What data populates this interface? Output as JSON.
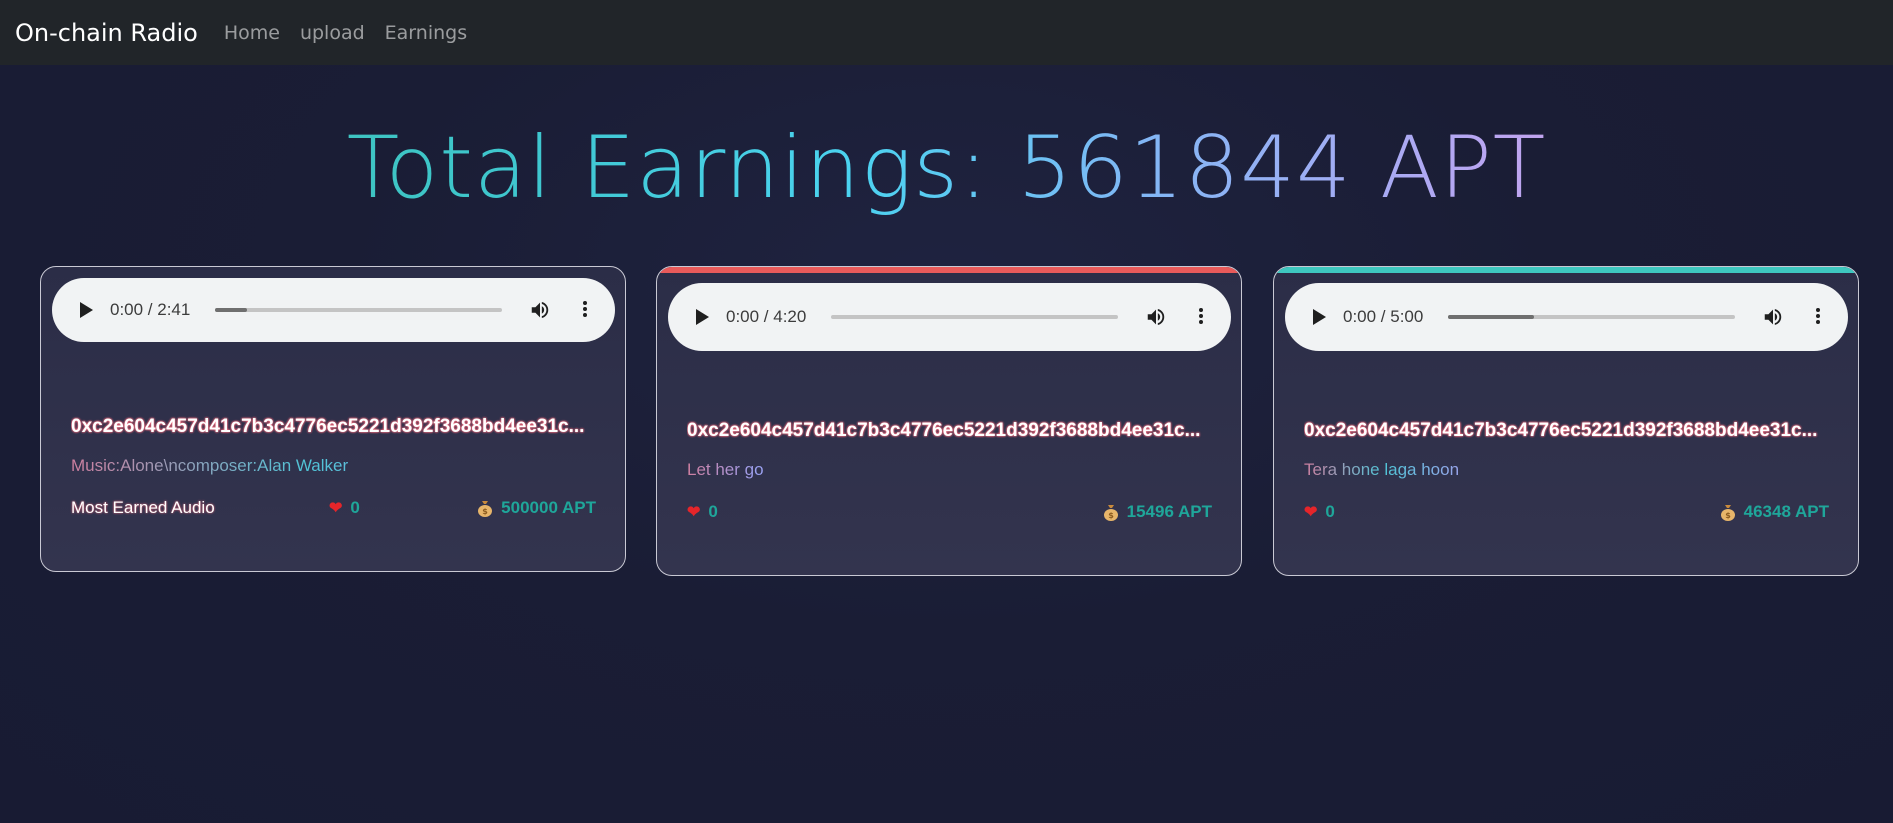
{
  "nav": {
    "brand": "On-chain Radio",
    "links": [
      "Home",
      "upload",
      "Earnings"
    ]
  },
  "header": {
    "label": "Total Earnings: ",
    "amount": "561844 APT"
  },
  "cards": [
    {
      "time": "0:00 / 2:41",
      "progress": 0.11,
      "owner": "0xc2e604c457d41c7b3c4776ec5221d392f3688bd4ee31c...",
      "description": "Music:Alone\\ncomposer:Alan Walker",
      "badge": "Most Earned Audio",
      "likes": "0",
      "earnings": "500000 APT",
      "accent": ""
    },
    {
      "time": "0:00 / 4:20",
      "progress": 0.0,
      "owner": "0xc2e604c457d41c7b3c4776ec5221d392f3688bd4ee31c...",
      "description": "Let her go",
      "badge": "",
      "likes": "0",
      "earnings": "15496 APT",
      "accent": "#e85a5a"
    },
    {
      "time": "0:00 / 5:00",
      "progress": 0.3,
      "owner": "0xc2e604c457d41c7b3c4776ec5221d392f3688bd4ee31c...",
      "description": "Tera hone laga hoon",
      "badge": "",
      "likes": "0",
      "earnings": "46348 APT",
      "accent": "#3ec7bf"
    }
  ],
  "icons": {
    "play": "play-icon",
    "volume": "volume-icon",
    "more": "more-options-icon",
    "heart": "heart-icon",
    "money": "money-bag-icon"
  }
}
